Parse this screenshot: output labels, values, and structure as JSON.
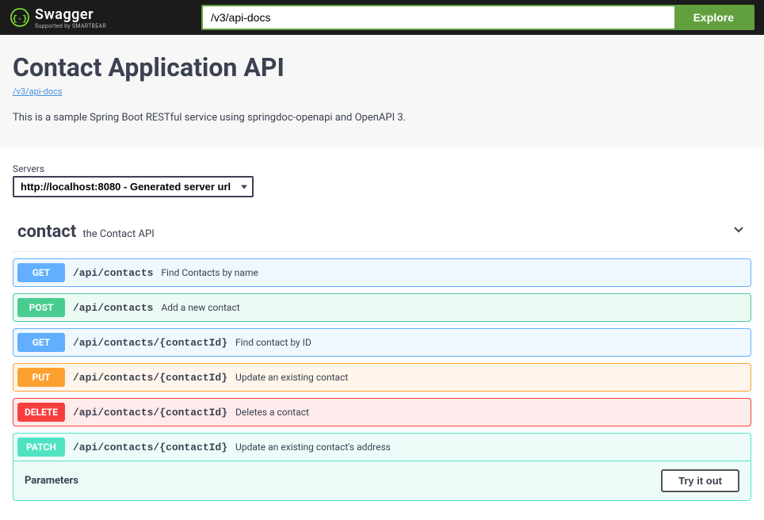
{
  "topbar": {
    "brand": "Swagger",
    "brand_sub": "Supported by SMARTBEAR",
    "url_value": "/v3/api-docs",
    "explore_label": "Explore"
  },
  "info": {
    "title": "Contact Application API",
    "spec_link": "/v3/api-docs",
    "description": "This is a sample Spring Boot RESTful service using springdoc-openapi and OpenAPI 3."
  },
  "servers": {
    "label": "Servers",
    "selected": "http://localhost:8080 - Generated server url"
  },
  "tag": {
    "name": "contact",
    "desc": "the Contact API"
  },
  "ops": [
    {
      "method": "GET",
      "cls": "op-get",
      "path": "/api/contacts",
      "summary": "Find Contacts by name"
    },
    {
      "method": "POST",
      "cls": "op-post",
      "path": "/api/contacts",
      "summary": "Add a new contact"
    },
    {
      "method": "GET",
      "cls": "op-get",
      "path": "/api/contacts/{contactId}",
      "summary": "Find contact by ID"
    },
    {
      "method": "PUT",
      "cls": "op-put",
      "path": "/api/contacts/{contactId}",
      "summary": "Update an existing contact"
    },
    {
      "method": "DELETE",
      "cls": "op-delete",
      "path": "/api/contacts/{contactId}",
      "summary": "Deletes a contact"
    },
    {
      "method": "PATCH",
      "cls": "op-patch",
      "path": "/api/contacts/{contactId}",
      "summary": "Update an existing contact's address"
    }
  ],
  "expanded": {
    "parameters_label": "Parameters",
    "try_label": "Try it out"
  }
}
